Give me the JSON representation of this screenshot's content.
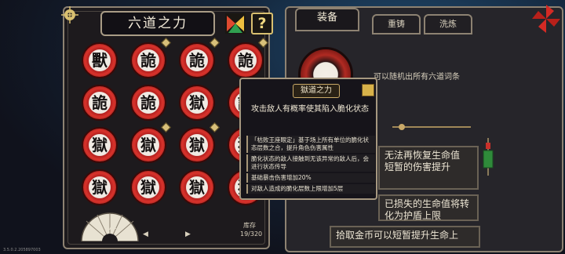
{
  "left_panel": {
    "title": "六道之力",
    "help_label": "?",
    "grid": [
      [
        "獸",
        "詭",
        "詭",
        "詭"
      ],
      [
        "詭",
        "詭",
        "獄",
        "詭"
      ],
      [
        "獄",
        "獄",
        "獄",
        "獄"
      ],
      [
        "獄",
        "獄",
        "獄",
        "獄"
      ]
    ],
    "badges": [
      [
        false,
        true,
        true,
        true
      ],
      [
        false,
        false,
        false,
        false
      ],
      [
        false,
        true,
        true,
        false
      ],
      [
        false,
        false,
        false,
        false
      ]
    ],
    "page": "1/2",
    "page_prev": "◀",
    "page_next": "▶",
    "stock_label": "库存",
    "stock_value": "19/320"
  },
  "right_panel": {
    "tabs": [
      {
        "label": "装备",
        "active": true
      },
      {
        "label": "重铸",
        "active": false
      },
      {
        "label": "洗炼",
        "active": false
      }
    ],
    "top_desc": "可以随机出所有六道词条",
    "slot_1": {
      "highlight": "",
      "text": "无法再恢复生命值"
    },
    "slot_2": {
      "highlight": "",
      "text": "短暂的伤害提升"
    },
    "slot_3": {
      "highlight": "",
      "text": "已损失的生命值将转化为护盾上限"
    },
    "slot_4": {
      "text": "拾取金币可以短暂提升生命上"
    }
  },
  "tooltip": {
    "header": "獄道之力",
    "title": "攻击敌人有概率使其陷入脆化状态",
    "lines": [
      "「枯败王座眼定」基于场上所有单位的脆化状态层数之合，提升角色伤害属性",
      "脆化状态的敌人接触到无该异常的敌人后，会进行状态传导",
      "基础暴击伤害增加20%",
      "对敌人造成的脆化层数上限增加5层"
    ]
  },
  "version": "3.5.0.2.205897003",
  "colors": {
    "accent_red": "#d9332c",
    "gold": "#d9c070",
    "highlight_blue": "#5fb2f0"
  }
}
